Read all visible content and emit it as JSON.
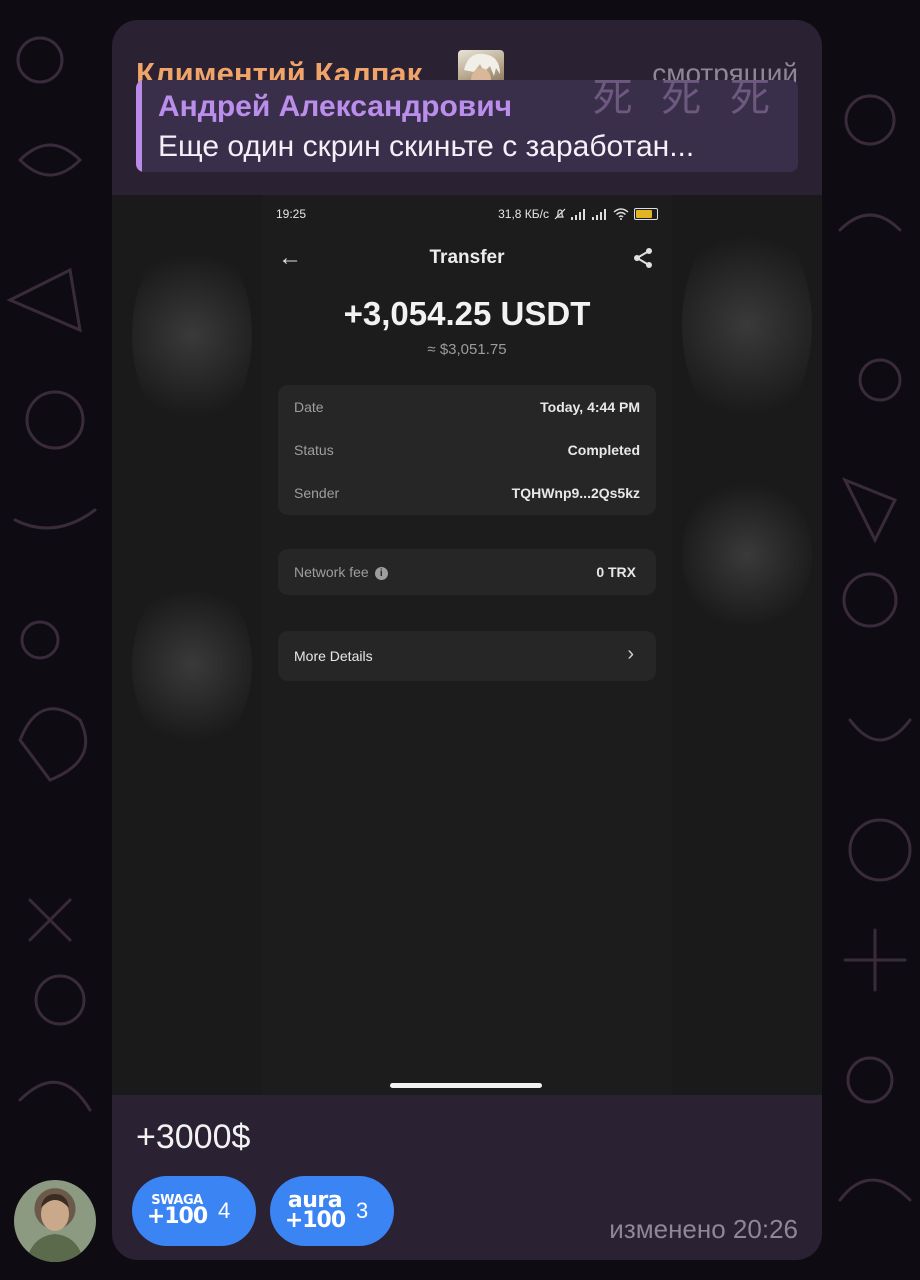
{
  "message": {
    "sender_name": "Климентий Калпак",
    "sender_role": "смотрящий",
    "reply": {
      "author": "Андрей Александрович",
      "text": "Еще один скрин скиньте с заработан...",
      "decor_text": "死 死 死"
    },
    "text": "+3000$",
    "edited_time": "изменено 20:26",
    "reactions": [
      {
        "emoji_top": "SWAGA",
        "emoji_bottom": "+100",
        "count": "4"
      },
      {
        "emoji_top": "aura",
        "emoji_bottom": "+100",
        "count": "3"
      }
    ]
  },
  "screenshot": {
    "status": {
      "time": "19:25",
      "speed": "31,8 КБ/с",
      "battery": "88"
    },
    "title": "Transfer",
    "amount": "+3,054.25 USDT",
    "amount_usd": "≈ $3,051.75",
    "rows": [
      {
        "label": "Date",
        "value": "Today, 4:44 PM"
      },
      {
        "label": "Status",
        "value": "Completed"
      },
      {
        "label": "Sender",
        "value": "TQHWnp9...2Qs5kz"
      }
    ],
    "fee": {
      "label": "Network fee",
      "value": "0 TRX"
    },
    "more": {
      "label": "More Details"
    }
  },
  "colors": {
    "bubble": "#2a2132",
    "sender": "#f0a46a",
    "reply_author": "#bb8eec",
    "reaction": "#3b84f4"
  }
}
